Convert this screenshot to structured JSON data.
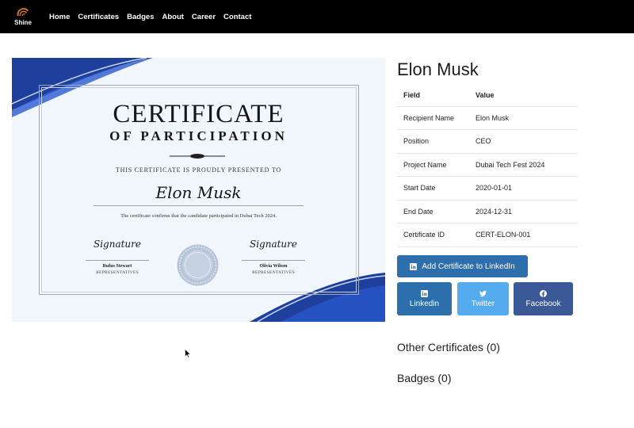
{
  "brand": {
    "name": "Shine"
  },
  "nav": {
    "items": [
      "Home",
      "Certificates",
      "Badges",
      "About",
      "Career",
      "Contact"
    ]
  },
  "certificate": {
    "title_line1": "CERTIFICATE",
    "title_line2": "OF PARTICIPATION",
    "presented": "THIS CERTIFICATE IS PROUDLY PRESENTED TO",
    "recipient": "Elon Musk",
    "confirmation": "The certificate confirms that the candidate participated in Dubai Tech 2024.",
    "signatory_left": {
      "signature": "Signature",
      "name": "Rufus Stewart",
      "role": "REPRESENTATIVES"
    },
    "signatory_right": {
      "signature": "Signature",
      "name": "Olivia Wilson",
      "role": "REPRESENTATIVES"
    }
  },
  "profile": {
    "name": "Elon Musk",
    "table_headers": [
      "Field",
      "Value"
    ],
    "rows": [
      {
        "field": "Recipient Name",
        "value": "Elon Musk"
      },
      {
        "field": "Position",
        "value": "CEO"
      },
      {
        "field": "Project Name",
        "value": "Dubai Tech Fest 2024"
      },
      {
        "field": "Start Date",
        "value": "2020-01-01"
      },
      {
        "field": "End Date",
        "value": "2024-12-31"
      },
      {
        "field": "Certificate ID",
        "value": "CERT-ELON-001"
      }
    ]
  },
  "actions": {
    "add_linkedin": "Add Certificate to LinkedIn",
    "share_linkedin": "Linkedin",
    "share_twitter": "Twitter",
    "share_facebook": "Facebook"
  },
  "sections": {
    "other_certificates": "Other Certificates (0)",
    "badges": "Badges (0)"
  },
  "colors": {
    "navbar": "#000000",
    "linkedin": "#2d6fad",
    "twitter": "#54acee",
    "facebook": "#3b5897",
    "certificate_blue": "#1e3f9c"
  }
}
